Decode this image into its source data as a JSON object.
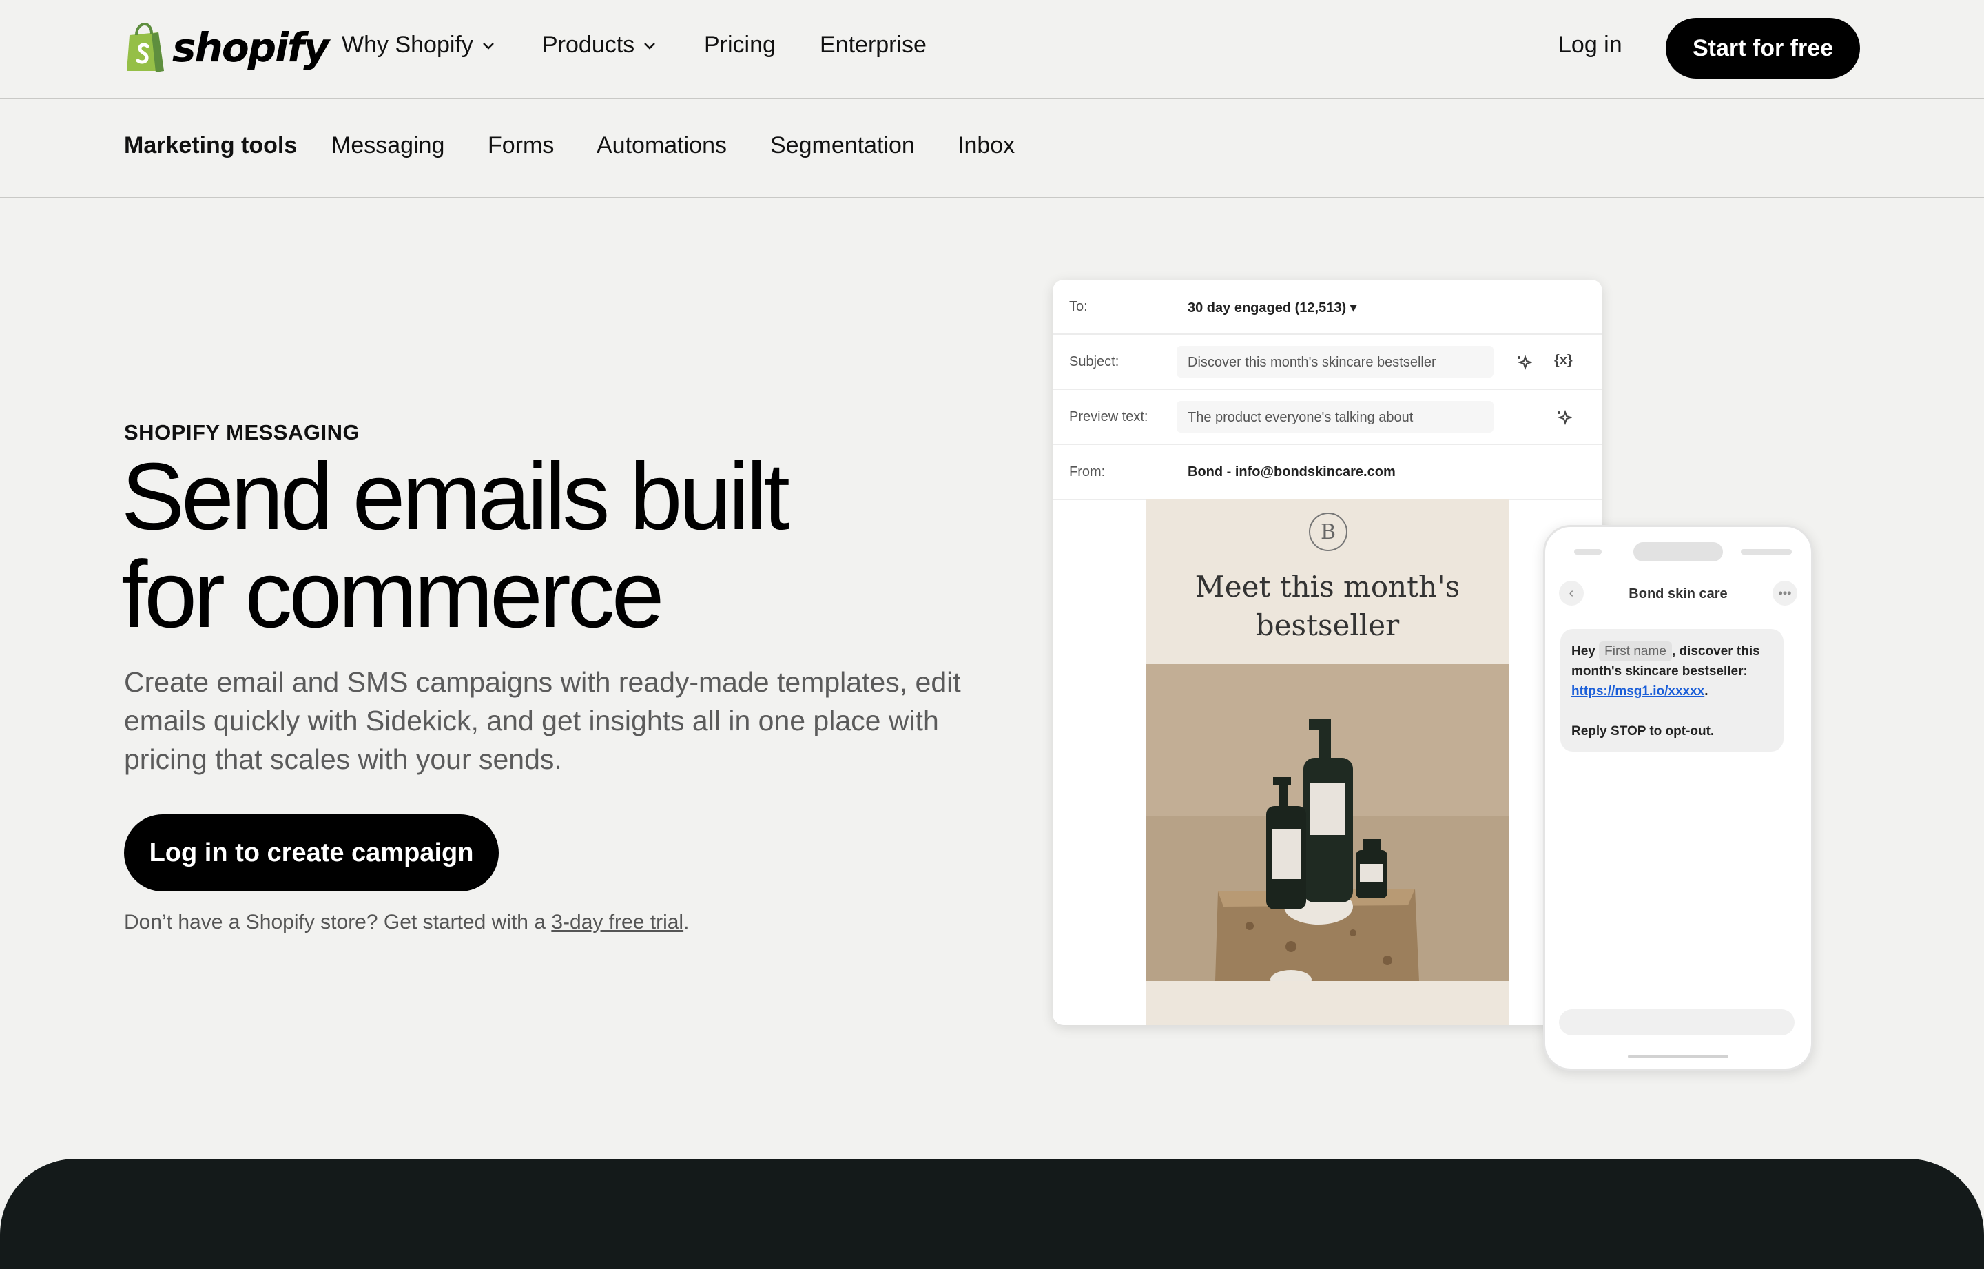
{
  "nav": {
    "brand": "shopify",
    "links": [
      "Why Shopify",
      "Products",
      "Pricing",
      "Enterprise"
    ],
    "login": "Log in",
    "cta": "Start for free"
  },
  "subnav": {
    "items": [
      "Marketing tools",
      "Messaging",
      "Forms",
      "Automations",
      "Segmentation",
      "Inbox"
    ]
  },
  "hero": {
    "eyebrow": "SHOPIFY MESSAGING",
    "headline_line1": "Send emails built",
    "headline_line2": "for commerce",
    "subcopy": "Create email and SMS campaigns with ready-made templates, edit emails quickly with Sidekick, and get insights all in one place with pricing that scales with your sends.",
    "cta": "Log in to create campaign",
    "trial_prefix": "Don’t have a Shopify store? Get started with a ",
    "trial_link": "3-day free trial",
    "trial_suffix": "."
  },
  "email_card": {
    "to_label": "To:",
    "to_value": "30 day engaged (12,513) ▾",
    "subject_label": "Subject:",
    "subject_value": "Discover this month's skincare bestseller",
    "preview_label": "Preview text:",
    "preview_value": "The product everyone's talking about",
    "from_label": "From:",
    "from_value": "Bond - info@bondskincare.com",
    "variable_icon": "{x}",
    "brand_mark": "B",
    "title_line1": "Meet this month's",
    "title_line2": "bestseller"
  },
  "phone": {
    "title": "Bond skin care",
    "back_icon": "‹",
    "more_icon": "•••",
    "sms_hey": "Hey ",
    "sms_chip": "First name",
    "sms_rest": ", discover this month's skincare bestseller:",
    "sms_link": "https://msg1.io/xxxxx",
    "sms_link_suffix": ".",
    "sms_optout": "Reply STOP to opt-out."
  },
  "colors": {
    "page_bg": "#f2f2f0",
    "button_bg": "#000000",
    "footer_band": "#141a1a",
    "brand_green": "#95bf47",
    "link_blue": "#1a5ed8"
  }
}
